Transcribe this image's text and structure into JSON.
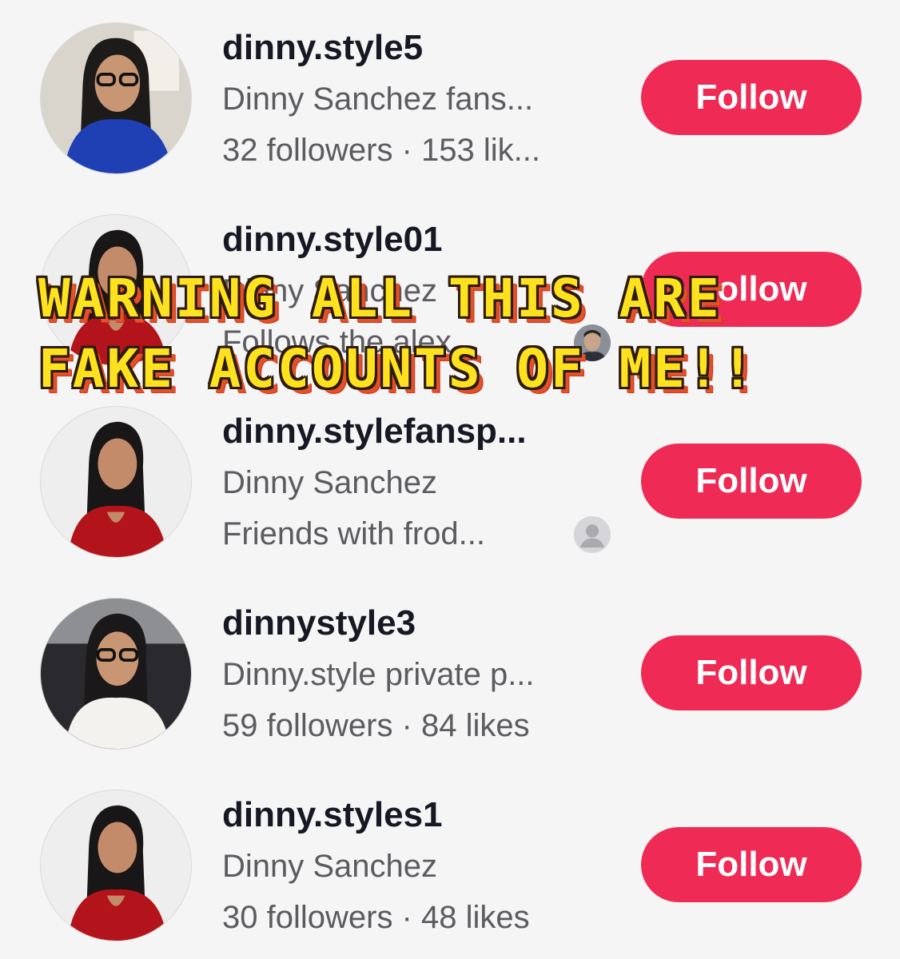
{
  "accounts": [
    {
      "username": "dinny.style5",
      "subtitle": "Dinny Sanchez fans...",
      "info": "32 followers · 153 lik...",
      "follow_label": "Follow",
      "avatar": "woman-glasses-blue-top"
    },
    {
      "username": "dinny.style01",
      "subtitle": "Dinny Sanchez",
      "info": "Follows the.alex...",
      "follow_label": "Follow",
      "avatar": "woman-red-top",
      "mini_avatar": "man-face-icon"
    },
    {
      "username": "dinny.stylefansp...",
      "subtitle": "Dinny Sanchez",
      "info": "Friends with frod...",
      "follow_label": "Follow",
      "avatar": "woman-red-top",
      "mini_avatar": "default-user-icon"
    },
    {
      "username": "dinnystyle3",
      "subtitle": "Dinny.style private p...",
      "info": "59 followers · 84 likes",
      "follow_label": "Follow",
      "avatar": "woman-glasses-white-top"
    },
    {
      "username": "dinny.styles1",
      "subtitle": "Dinny Sanchez",
      "info": "30 followers · 48 likes",
      "follow_label": "Follow",
      "avatar": "woman-red-top"
    }
  ],
  "warning": {
    "line1": "WARNING ALL THIS ARE",
    "line2": "FAKE ACCOUNTS OF ME!!"
  },
  "colors": {
    "follow_button": "#ef2b55",
    "warning_fill": "#ffe21f",
    "warning_shadow": "#e3502a"
  }
}
